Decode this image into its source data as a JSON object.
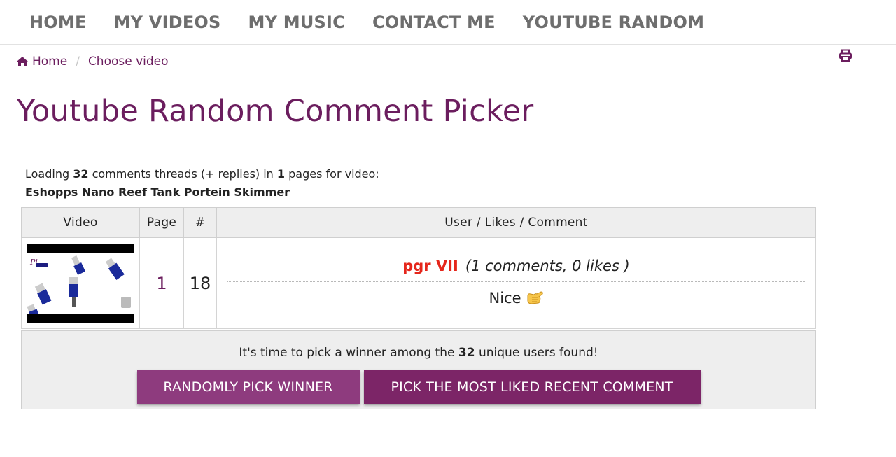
{
  "nav": {
    "items": [
      "HOME",
      "MY VIDEOS",
      "MY MUSIC",
      "CONTACT ME",
      "YOUTUBE RANDOM"
    ]
  },
  "breadcrumb": {
    "home_label": "Home",
    "separator": "/",
    "current": "Choose video"
  },
  "page_title": "Youtube Random Comment Picker",
  "loading": {
    "prefix": "Loading ",
    "thread_count": "32",
    "middle": " comments threads (+ replies) in ",
    "page_count": "1",
    "suffix": " pages for video:",
    "video_title": "Eshopps Nano Reef Tank Portein Skimmer"
  },
  "table": {
    "headers": {
      "video": "Video",
      "page": "Page",
      "number": "#",
      "user": "User / Likes / Comment"
    },
    "rows": [
      {
        "page": "1",
        "number": "18",
        "user_name": "pgr VII",
        "meta": "(1 comments, 0 likes )",
        "comment": "Nice"
      }
    ]
  },
  "winner": {
    "prefix": "It's time to pick a winner among the ",
    "count": "32",
    "suffix": " unique users found!",
    "random_button": "RANDOMLY PICK WINNER",
    "liked_button": "PICK THE MOST LIKED RECENT COMMENT"
  },
  "colors": {
    "accent": "#6b1d5e",
    "username": "#e5261b",
    "button_random": "#8e3b7e",
    "button_liked": "#7c2567"
  },
  "icons": {
    "breadcrumb_home": "home-icon",
    "print": "print-icon",
    "comment_emoji": "call-me-hand-emoji"
  }
}
